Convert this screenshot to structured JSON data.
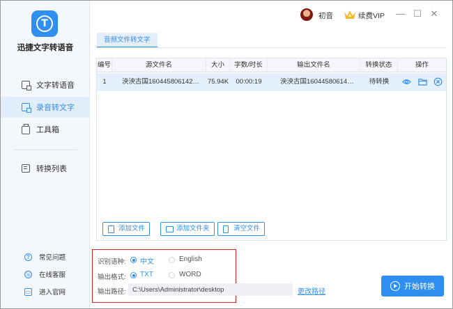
{
  "app": {
    "title": "迅捷文字转语音"
  },
  "sidebar": {
    "items": [
      {
        "label": "文字转语音",
        "icon": "text-to-speech-icon",
        "active": false
      },
      {
        "label": "录音转文字",
        "icon": "audio-to-text-icon",
        "active": true
      },
      {
        "label": "工具箱",
        "icon": "toolbox-icon",
        "active": false
      },
      {
        "label": "转换列表",
        "icon": "conversion-list-icon",
        "active": false
      }
    ],
    "bottom_links": [
      {
        "label": "常见问题",
        "icon": "help-icon"
      },
      {
        "label": "在线客服",
        "icon": "headset-icon"
      },
      {
        "label": "进入官网",
        "icon": "website-icon"
      }
    ]
  },
  "topbar": {
    "user_name": "初音",
    "vip_label": "续费VIP",
    "minimize": "—",
    "maximize": "☐",
    "close": "✕"
  },
  "tabs": [
    {
      "label": "音频文件转文字",
      "active": true
    }
  ],
  "table": {
    "columns": [
      "编号",
      "源文件名",
      "大小",
      "字数/时长",
      "输出文件名",
      "转换状态",
      "操作"
    ],
    "rows": [
      {
        "index": "1",
        "source": "泱泱古国1604458061420.mp3",
        "size": "75.94K",
        "duration": "00:00:19",
        "output": "泱泱古国1604458061420.txt",
        "status": "待转换"
      }
    ]
  },
  "file_buttons": {
    "add_file": "添加文件",
    "add_folder": "添加文件夹",
    "clear": "清空文件"
  },
  "options": {
    "language_label": "识别语种:",
    "language_options": [
      {
        "label": "中文",
        "selected": true
      },
      {
        "label": "English",
        "selected": false
      }
    ],
    "format_label": "输出格式:",
    "format_options": [
      {
        "label": "TXT",
        "selected": true
      },
      {
        "label": "WORD",
        "selected": false
      }
    ],
    "path_label": "输出路径:",
    "path_value": "C:\\Users\\Administrator\\desktop",
    "change_path": "更改路径"
  },
  "start_button": "开始转换",
  "colors": {
    "accent": "#2f8ff0",
    "highlight_box": "#d9262c",
    "row_selected": "#e4f0fc",
    "sidebar_bg": "#f4f7fb"
  }
}
